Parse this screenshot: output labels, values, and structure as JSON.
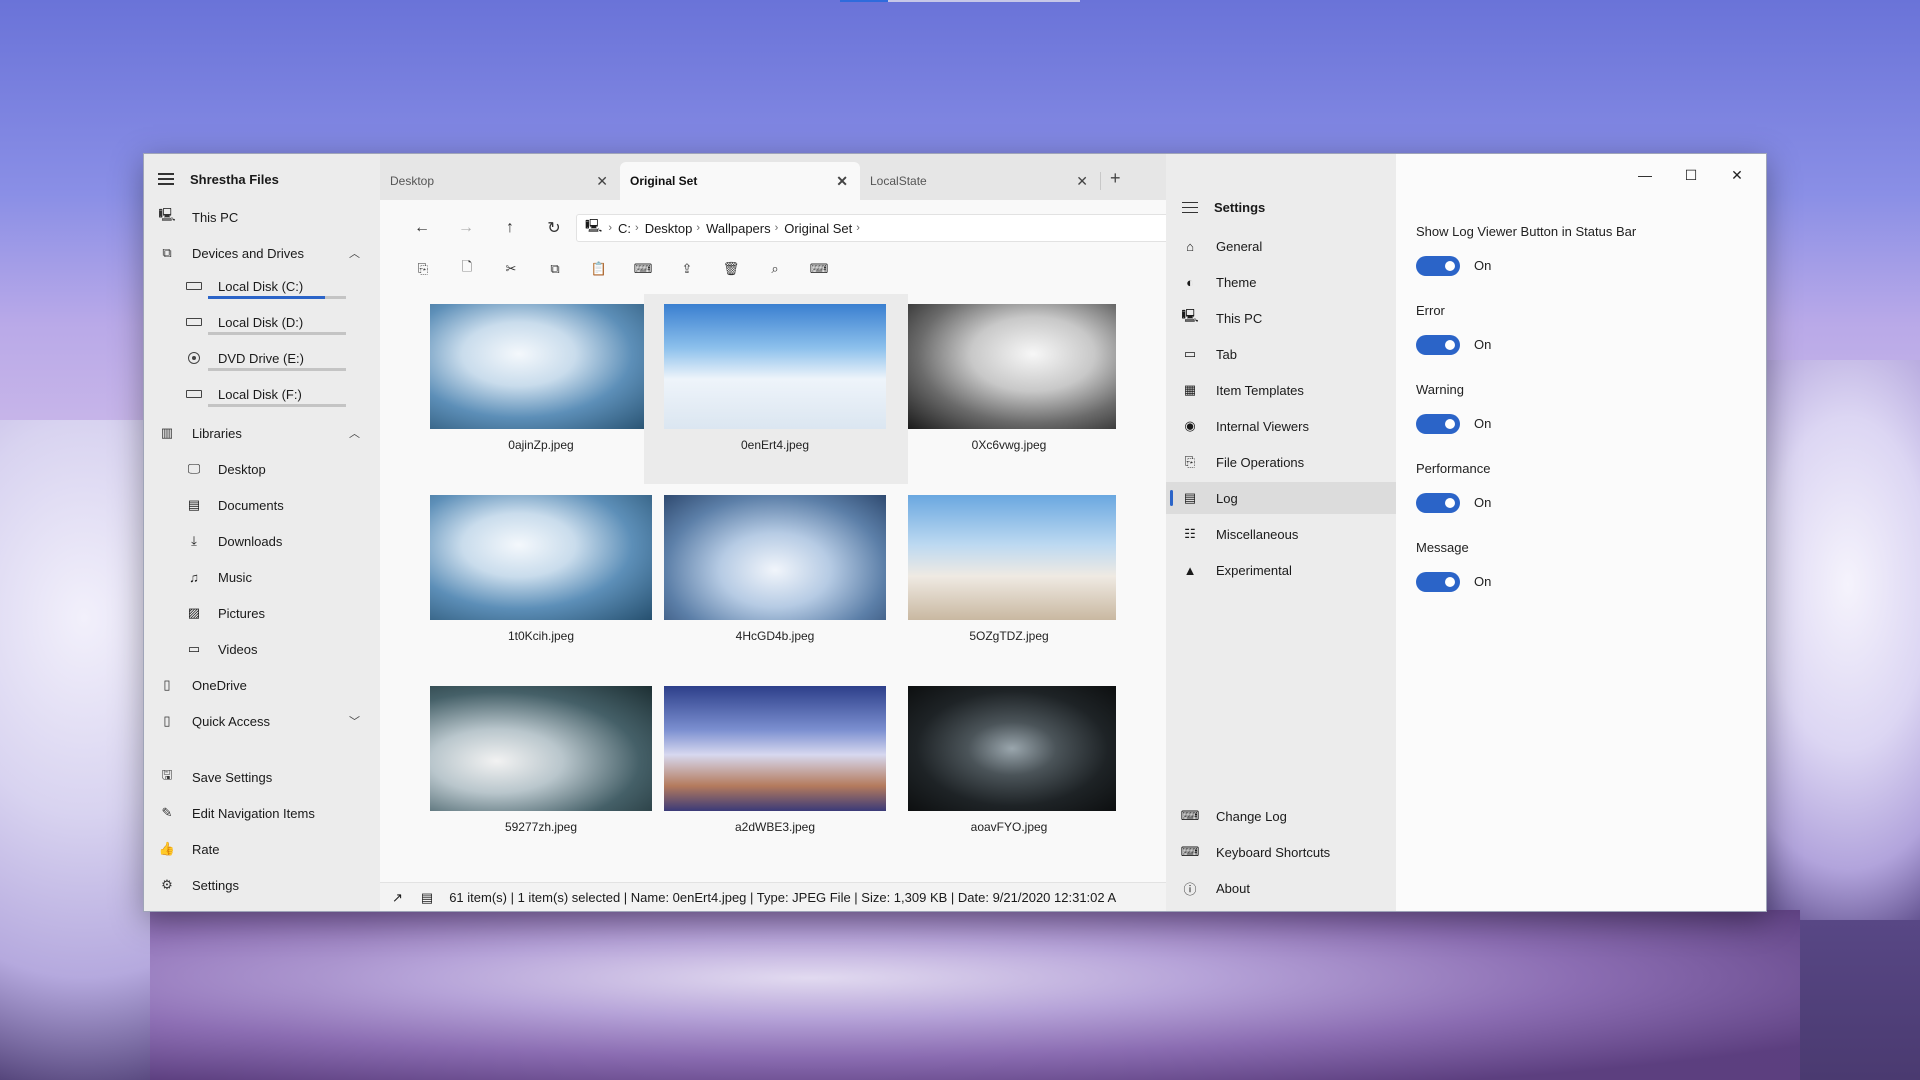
{
  "app": {
    "title": "Shrestha Files"
  },
  "sidebar": {
    "this_pc": "This PC",
    "devices_header": "Devices and Drives",
    "drives": [
      {
        "label": "Local Disk (C:)",
        "icon": "drive-icon",
        "usage": 0.85
      },
      {
        "label": "Local Disk (D:)",
        "icon": "drive-icon",
        "usage": 0.0
      },
      {
        "label": "DVD Drive (E:)",
        "icon": "dvd-icon",
        "usage": 0.0
      },
      {
        "label": "Local Disk (F:)",
        "icon": "drive-icon",
        "usage": 0.0
      }
    ],
    "libraries_header": "Libraries",
    "libraries": [
      {
        "label": "Desktop",
        "icon": "desktop-icon"
      },
      {
        "label": "Documents",
        "icon": "documents-icon"
      },
      {
        "label": "Downloads",
        "icon": "download-icon"
      },
      {
        "label": "Music",
        "icon": "music-icon"
      },
      {
        "label": "Pictures",
        "icon": "pictures-icon"
      },
      {
        "label": "Videos",
        "icon": "videos-icon"
      }
    ],
    "onedrive": "OneDrive",
    "quick_access": "Quick Access",
    "footer": {
      "save_settings": "Save Settings",
      "edit_nav": "Edit Navigation Items",
      "rate": "Rate",
      "settings": "Settings"
    }
  },
  "tabs": [
    {
      "label": "Desktop",
      "active": false
    },
    {
      "label": "Original Set",
      "active": true
    },
    {
      "label": "LocalState",
      "active": false
    }
  ],
  "breadcrumb": [
    "C:",
    "Desktop",
    "Wallpapers",
    "Original Set"
  ],
  "files": [
    {
      "name": "0ajinZp.jpeg",
      "selected": false
    },
    {
      "name": "0enErt4.jpeg",
      "selected": true
    },
    {
      "name": "0Xc6vwg.jpeg",
      "selected": false
    },
    {
      "name": "1t0Kcih.jpeg",
      "selected": false
    },
    {
      "name": "4HcGD4b.jpeg",
      "selected": false
    },
    {
      "name": "5OZgTDZ.jpeg",
      "selected": false
    },
    {
      "name": "59277zh.jpeg",
      "selected": false
    },
    {
      "name": "a2dWBE3.jpeg",
      "selected": false
    },
    {
      "name": "aoavFYO.jpeg",
      "selected": false
    }
  ],
  "status": {
    "text": "61 item(s)  |  1 item(s) selected  |  Name: 0enErt4.jpeg  |  Type: JPEG File  |  Size: 1,309 KB  |  Date: 9/21/2020 12:31:02 A"
  },
  "settings": {
    "header": "Settings",
    "items": [
      {
        "label": "General",
        "icon": "home-icon"
      },
      {
        "label": "Theme",
        "icon": "palette-icon"
      },
      {
        "label": "This PC",
        "icon": "pc-icon"
      },
      {
        "label": "Tab",
        "icon": "tab-icon"
      },
      {
        "label": "Item Templates",
        "icon": "grid-icon"
      },
      {
        "label": "Internal Viewers",
        "icon": "eye-icon"
      },
      {
        "label": "File Operations",
        "icon": "file-ops-icon"
      },
      {
        "label": "Log",
        "icon": "log-icon"
      },
      {
        "label": "Miscellaneous",
        "icon": "misc-icon"
      },
      {
        "label": "Experimental",
        "icon": "warning-icon"
      }
    ],
    "active": "Log",
    "footer": [
      {
        "label": "Change Log",
        "icon": "changelog-icon"
      },
      {
        "label": "Keyboard Shortcuts",
        "icon": "keyboard-icon"
      },
      {
        "label": "About",
        "icon": "info-icon"
      }
    ]
  },
  "log_options": [
    {
      "label": "Show Log Viewer Button in Status Bar",
      "state": "On"
    },
    {
      "label": "Error",
      "state": "On"
    },
    {
      "label": "Warning",
      "state": "On"
    },
    {
      "label": "Performance",
      "state": "On"
    },
    {
      "label": "Message",
      "state": "On"
    }
  ],
  "colors": {
    "accent": "#2b64c8"
  }
}
